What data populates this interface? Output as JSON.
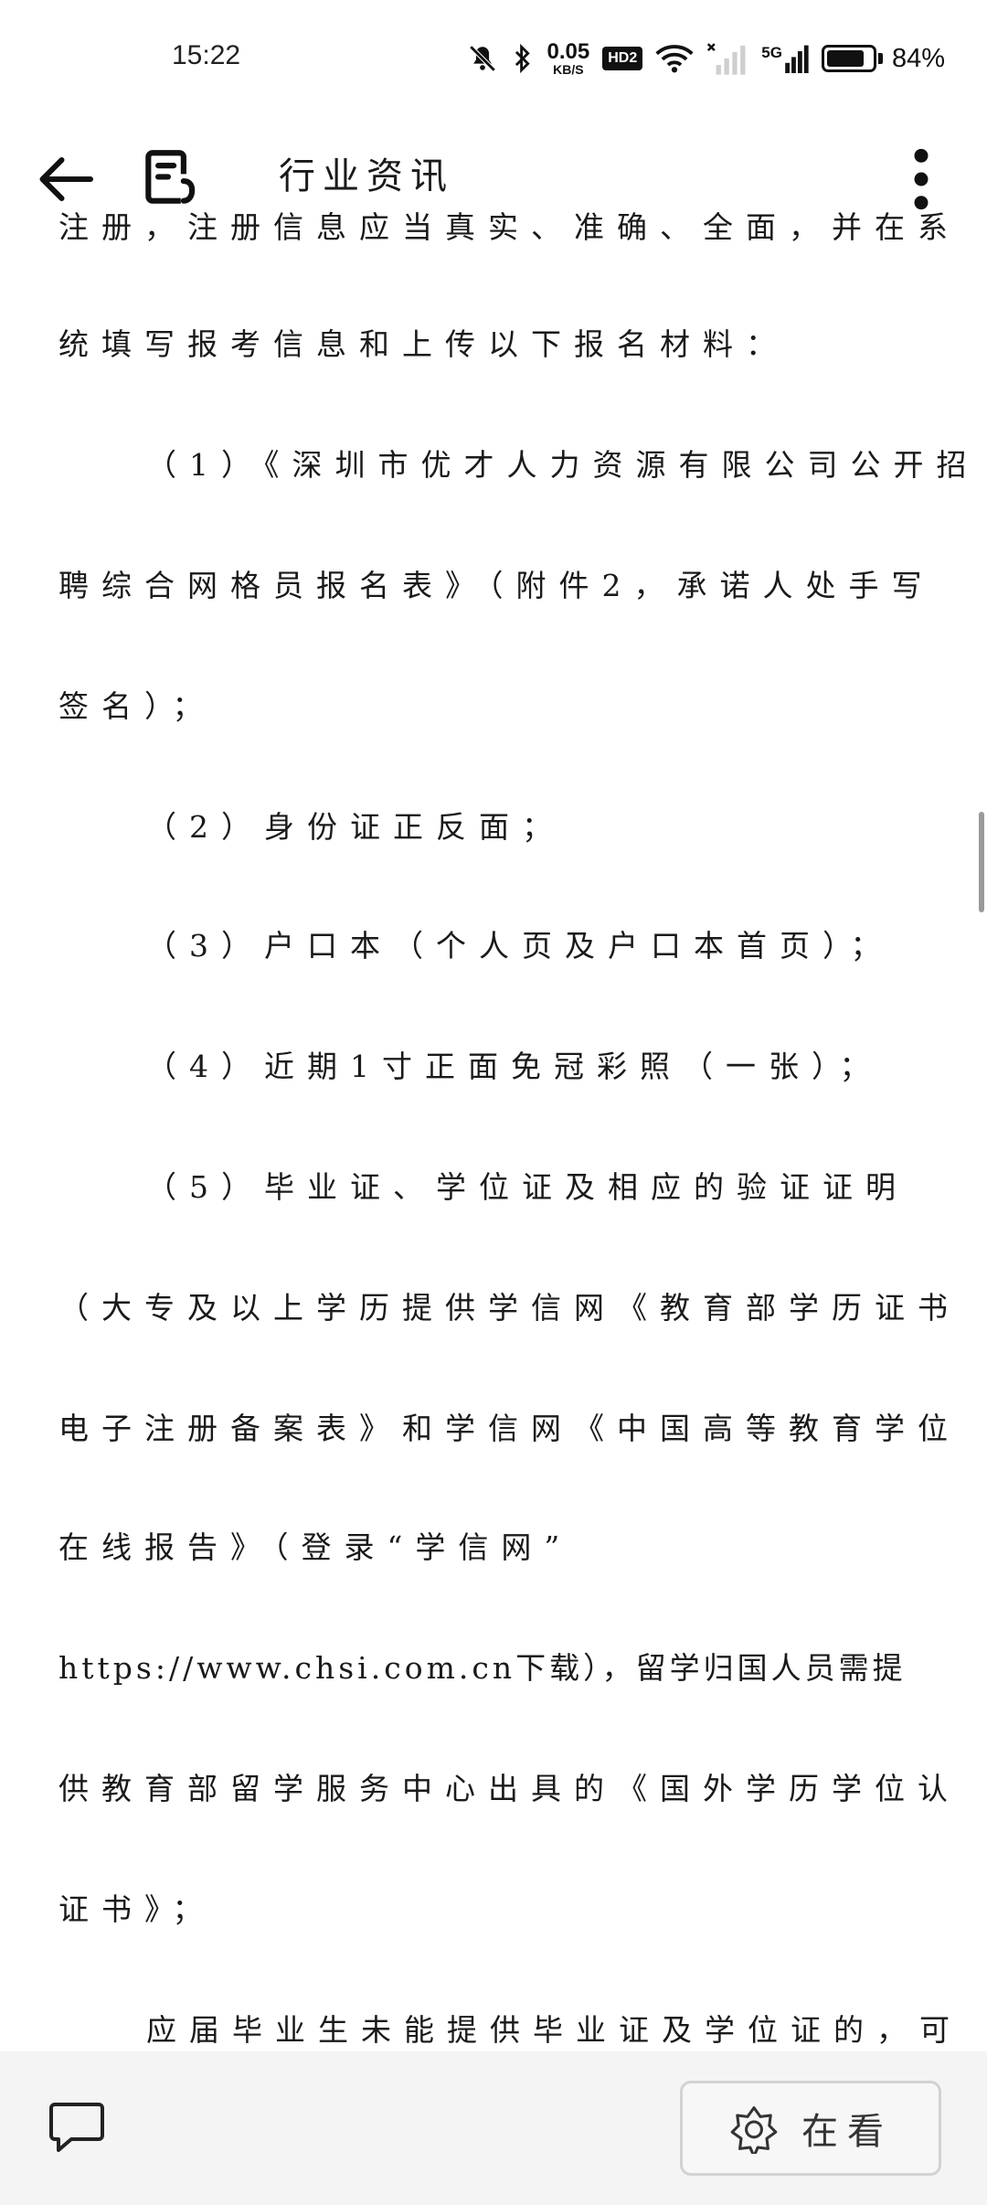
{
  "status_bar": {
    "time": "15:22",
    "net_speed_value": "0.05",
    "net_speed_unit": "KB/S",
    "hd_badge": "HD2",
    "network_label": "5G",
    "battery_percent": "84%",
    "battery_level": 0.84
  },
  "app_bar": {
    "title": "行业资讯",
    "icons": [
      "back-arrow-icon",
      "document-icon",
      "more-vertical-icon"
    ]
  },
  "article": {
    "lines": [
      "注册，注册信息应当真实、准确、全面，并在系",
      "统填写报考信息和上传以下报名材料：",
      "（1）《深圳市优才人力资源有限公司公开招",
      "聘综合网格员报名表》（附件2，承诺人处手写",
      "签名）；",
      "（2）身份证正反面；",
      "（3）户口本（个人页及户口本首页）；",
      "（4）近期1寸正面免冠彩照（一张）；",
      "（5）毕业证、学位证及相应的验证证明",
      "（大专及以上学历提供学信网《教育部学历证书",
      "电子注册备案表》和学信网《中国高等教育学位",
      "在线报告》（登录“学信网”",
      "https://www.chsi.com.cn下载），留学归国人员需提",
      "供教育部留学服务中心出具的《国外学历学位认",
      "证书》；",
      "应届毕业生未能提供毕业证及学位证的，可"
    ]
  },
  "bottom_bar": {
    "zaikan_label": "在看",
    "icons": [
      "comment-icon",
      "flower-icon"
    ]
  }
}
